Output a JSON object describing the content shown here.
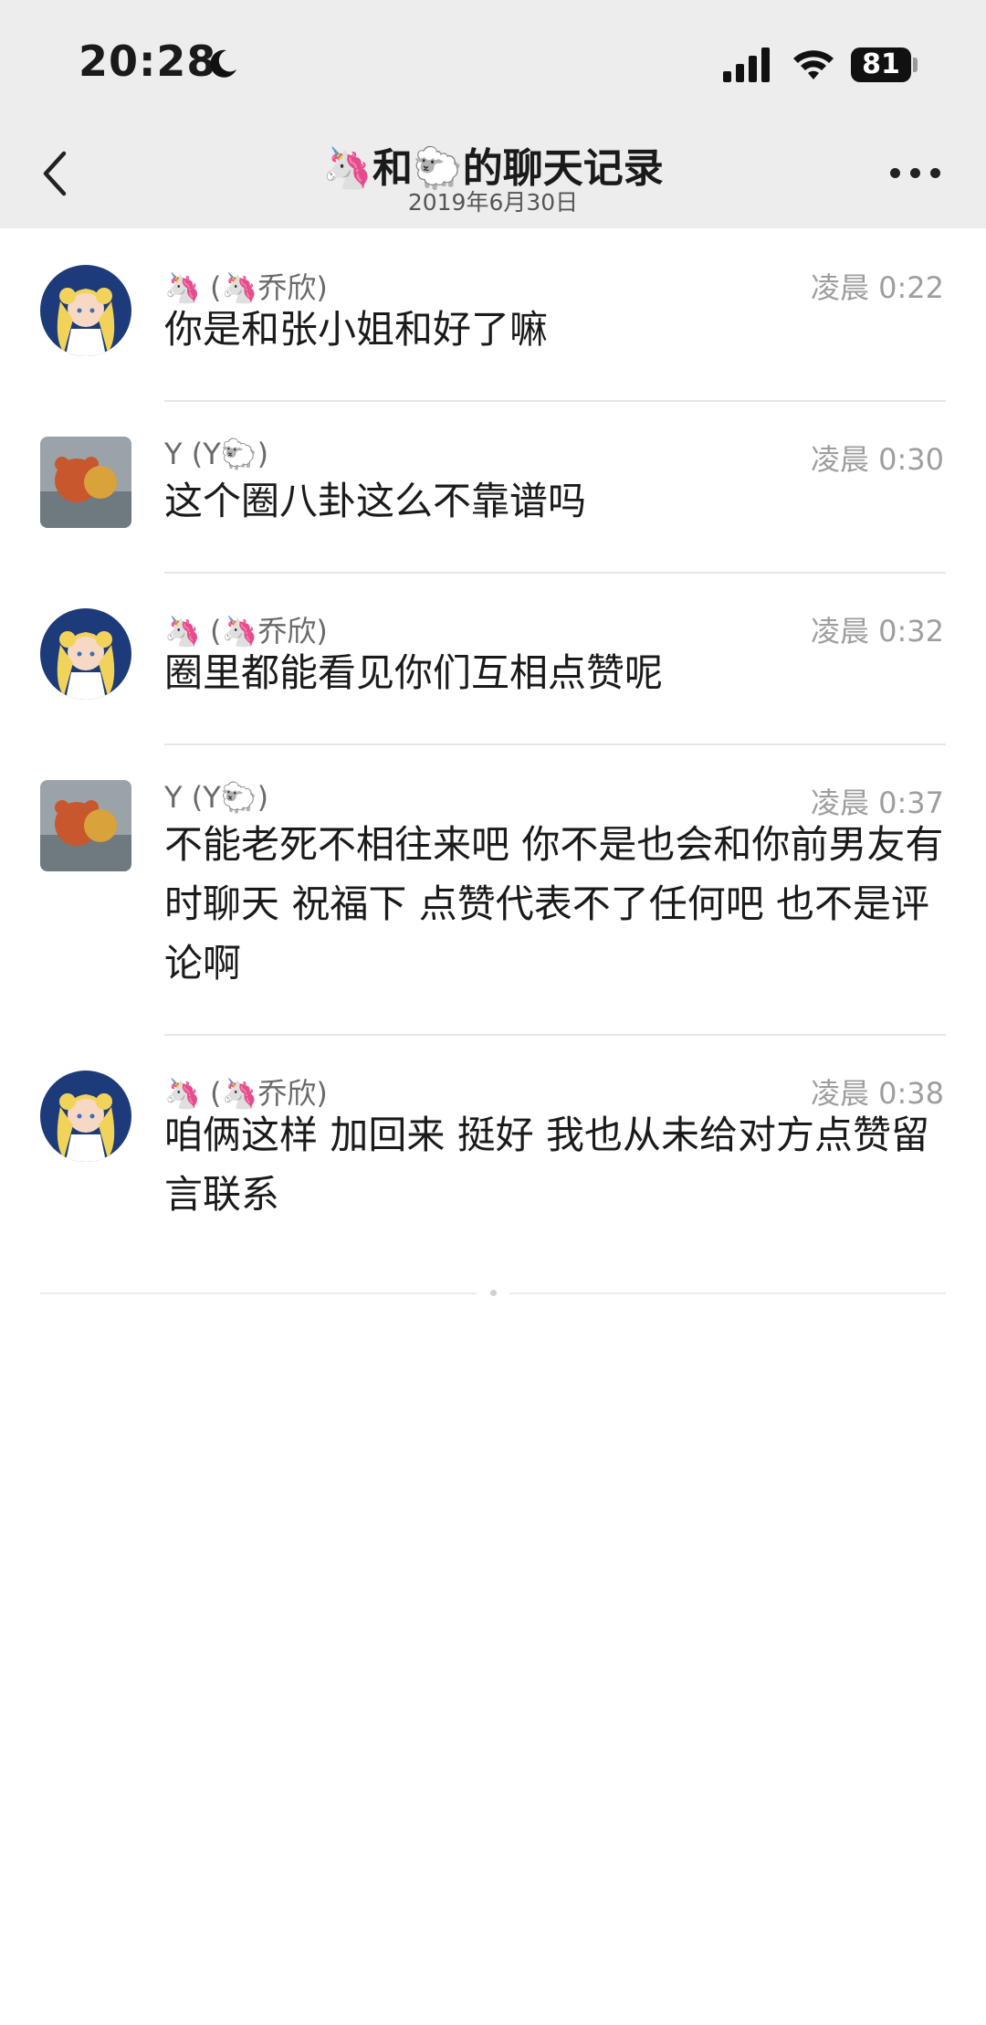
{
  "status_bar": {
    "time": "20:28",
    "battery": "81"
  },
  "nav": {
    "title": "🦄和🐑的聊天记录",
    "subtitle": "2019年6月30日"
  },
  "messages": [
    {
      "sender": "🦄 (🦄乔欣)",
      "time": "凌晨 0:22",
      "text": "你是和张小姐和好了嘛"
    },
    {
      "sender": "Y (Y🐑)",
      "time": "凌晨 0:30",
      "text": "这个圈八卦这么不靠谱吗"
    },
    {
      "sender": "🦄 (🦄乔欣)",
      "time": "凌晨 0:32",
      "text": "圈里都能看见你们互相点赞呢"
    },
    {
      "sender": "Y (Y🐑)",
      "time": "凌晨 0:37",
      "text": "不能老死不相往来吧 你不是也会和你前男友有时聊天 祝福下 点赞代表不了任何吧 也不是评论啊"
    },
    {
      "sender": "🦄 (🦄乔欣)",
      "time": "凌晨 0:38",
      "text": "咱俩这样 加回来 挺好  我也从未给对方点赞留言联系"
    }
  ],
  "icons": {
    "back": "chevron-left-icon",
    "more": "more-dots-icon",
    "moon": "moon-icon",
    "signal": "signal-icon",
    "wifi": "wifi-icon"
  }
}
